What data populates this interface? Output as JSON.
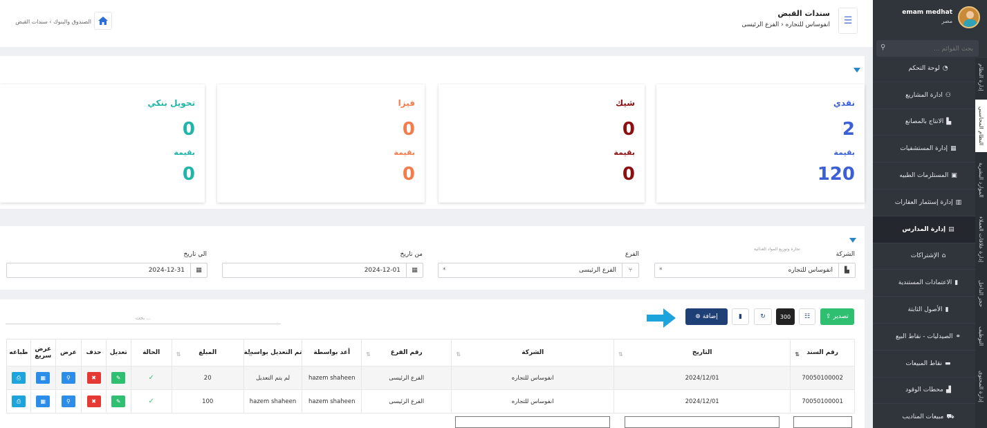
{
  "sidebar": {
    "user_name": "emam medhat",
    "user_role": "مصر",
    "search_placeholder": "بحث القوائم ...",
    "vertical_tabs": [
      "إدارة النظام",
      "النظام المحاسبي",
      "الموارد البشرية",
      "إدارة علاقات العملاء",
      "حجز الداخل",
      "التوظيف",
      "إدارة المحتوى"
    ],
    "items": [
      {
        "label": "لوحة التحكم",
        "icon": "dashboard-icon",
        "glyph": "◔"
      },
      {
        "label": "ادارة المشاريع",
        "icon": "handshake-icon",
        "glyph": "⚇"
      },
      {
        "label": "الانتاج بالمصانع",
        "icon": "factory-icon",
        "glyph": "▙"
      },
      {
        "label": "إدارة المستشفيات",
        "icon": "hospital-icon",
        "glyph": "▦"
      },
      {
        "label": "المستلزمات الطبيه",
        "icon": "medkit-icon",
        "glyph": "▣"
      },
      {
        "label": "إدارة إستثمار العقارات",
        "icon": "building-icon",
        "glyph": "▥"
      },
      {
        "label": "إدارة المدارس",
        "icon": "school-icon",
        "glyph": "▤",
        "active": true
      },
      {
        "label": "الإشتراكات",
        "icon": "bank-icon",
        "glyph": "⌂"
      },
      {
        "label": "الاعتمادات المستندية",
        "icon": "document-icon",
        "glyph": "▮"
      },
      {
        "label": "الأصول الثابتة",
        "icon": "file-icon",
        "glyph": "▮"
      },
      {
        "label": "الصيدليات - نقاط البيع",
        "icon": "binoculars-icon",
        "glyph": "⚭"
      },
      {
        "label": "نقاط المبيعات",
        "icon": "register-icon",
        "glyph": "▬"
      },
      {
        "label": "محطات الوقود",
        "icon": "gas-pump-icon",
        "glyph": "▟"
      },
      {
        "label": "مبيعات المناديب",
        "icon": "cart-icon",
        "glyph": "⛟"
      }
    ]
  },
  "header": {
    "title": "سندات القبض",
    "company": "انفوساس للتجاره",
    "branch": "الفرع الرئيسى",
    "breadcrumb": "الصندوق والبنوك  ›  سندات القبض"
  },
  "cards": [
    {
      "label": "نقدي",
      "count": "2",
      "value_label": "بقيمة",
      "value": "120",
      "color": "#3a5fd6"
    },
    {
      "label": "شيك",
      "count": "0",
      "value_label": "بقيمة",
      "value": "0",
      "color": "#8e0f12"
    },
    {
      "label": "فيزا",
      "count": "0",
      "value_label": "بقيمة",
      "value": "0",
      "color": "#f47b4a"
    },
    {
      "label": "تحويل بنكي",
      "count": "0",
      "value_label": "بقيمة",
      "value": "0",
      "color": "#1fb5a8"
    }
  ],
  "filters": {
    "company_label": "الشركة",
    "company_hint": "تجارة وتوزيع المواد الغذائية",
    "company_value": "انفوساس للتجاره",
    "branch_label": "الفرع",
    "branch_value": "الفرع الرئيسى",
    "from_label": "من تاريخ",
    "from_value": "2024-12-01",
    "to_label": "الي تاريخ",
    "to_value": "2024-12-31"
  },
  "toolbar": {
    "export_label": "تصدير",
    "page_size": "300",
    "add_label": "إضافة",
    "search_placeholder": "بحث ..."
  },
  "table": {
    "headers": [
      "رقم السند",
      "التاريخ",
      "الشركة",
      "رقم الفرع",
      "أعد بواسطة",
      "تم التعديل بواسطة",
      "المبلغ",
      "الحالة",
      "تعديل",
      "حذف",
      "عرض",
      "عرض سريع",
      "طباعه"
    ],
    "rows": [
      [
        "70050100002",
        "2024/12/01",
        "انفوساس للتجاره",
        "الفرع الرئيسى",
        "hazem shaheen",
        "لم يتم التعديل",
        "20"
      ],
      [
        "70050100001",
        "2024/12/01",
        "انفوساس للتجاره",
        "الفرع الرئيسى",
        "hazem shaheen",
        "hazem shaheen",
        "100"
      ]
    ],
    "status_glyph": "✓"
  },
  "colors": {
    "sidebar": "#30343b",
    "primary": "#1f3f77",
    "export": "#2fbf71",
    "accent_blue": "#2b8de8",
    "arrow": "#1ea4dc"
  }
}
